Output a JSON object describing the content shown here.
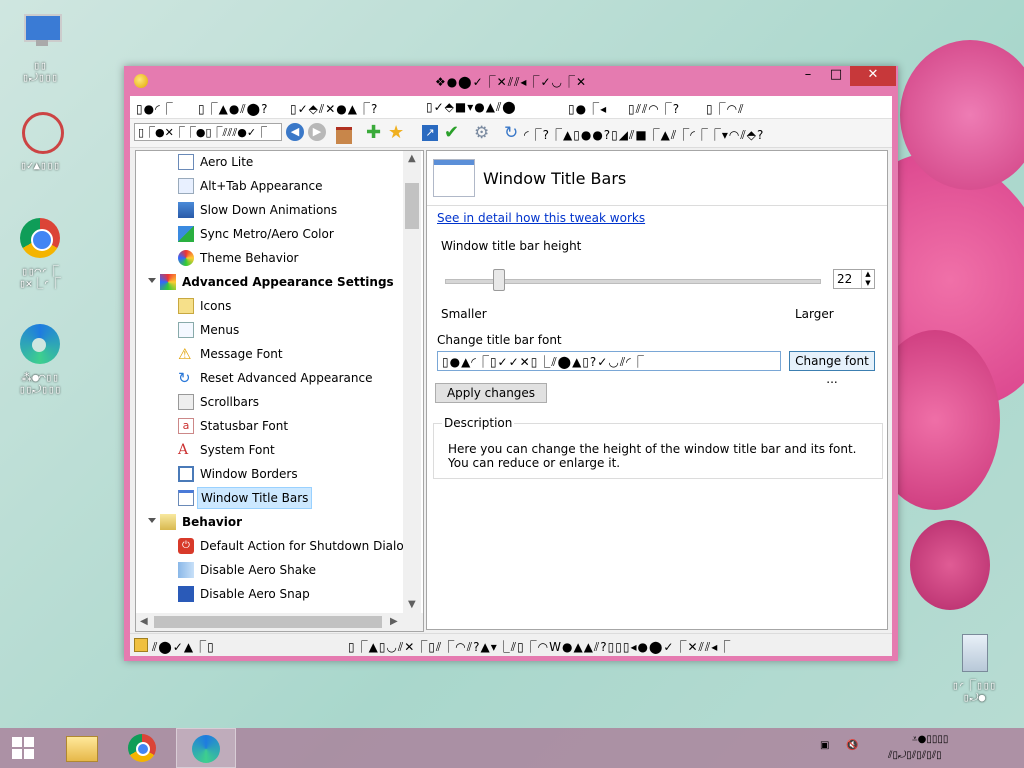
{
  "desktop": {
    "icons": [
      {
        "name": "this-pc",
        "label": "▯▯\n▯⤾▯▯▯"
      },
      {
        "name": "app-icon-2",
        "label": "▯✓▲▯▯▯"
      },
      {
        "name": "google-chrome",
        "label": "▯▯◠◜⎾\n▯✕⎿◜⎾"
      },
      {
        "name": "edge-app",
        "label": "⁂●◠▯▯\n▯▯⤾▯▯▯"
      },
      {
        "name": "recycle-bin",
        "label": "▯◜⎾▯▯▯\n▯⤾●"
      }
    ]
  },
  "window": {
    "title": "❖●⬤✓⎾✕⫽⫽◂⎾✓◡⎾✕",
    "menu": [
      "▯●◜⎾",
      "▯⎾▲●⫽⬤?",
      "▯✓⬘⫽✕●▲⎾?",
      "▯✓⬘■▾●▲⫽⬤",
      "▯●⎾◂",
      "▯⫽⫽◠⎾?",
      "▯⎾◠⫽"
    ],
    "toolbar": {
      "search_value": "▯⎾●✕⎾⎾●▯⎾⫽⫽⫽●✓⎾",
      "label": "◜⎾?⎾▲▯●●?▯◢⫽■⎾▲⫽⎾◜⎾⎾▾◠⫽⬘?"
    },
    "tree": {
      "items": [
        {
          "label": "Aero Lite",
          "icon": "window-icon",
          "type": "child"
        },
        {
          "label": "Alt+Tab Appearance",
          "icon": "alttab-icon",
          "type": "child"
        },
        {
          "label": "Slow Down Animations",
          "icon": "animation-icon",
          "type": "child"
        },
        {
          "label": "Sync Metro/Aero Color",
          "icon": "color-sync-icon",
          "type": "child"
        },
        {
          "label": "Theme Behavior",
          "icon": "theme-icon",
          "type": "child"
        },
        {
          "label": "Advanced Appearance Settings",
          "icon": "appearance-icon",
          "type": "group"
        },
        {
          "label": "Icons",
          "icon": "icons-icon",
          "type": "child"
        },
        {
          "label": "Menus",
          "icon": "menus-icon",
          "type": "child"
        },
        {
          "label": "Message Font",
          "icon": "warning-icon",
          "type": "child"
        },
        {
          "label": "Reset Advanced Appearance",
          "icon": "reset-icon",
          "type": "child"
        },
        {
          "label": "Scrollbars",
          "icon": "scrollbar-icon",
          "type": "child"
        },
        {
          "label": "Statusbar Font",
          "icon": "statusbar-font-icon",
          "type": "child"
        },
        {
          "label": "System Font",
          "icon": "system-font-icon",
          "type": "child"
        },
        {
          "label": "Window Borders",
          "icon": "window-borders-icon",
          "type": "child"
        },
        {
          "label": "Window Title Bars",
          "icon": "title-bar-icon",
          "type": "child",
          "selected": true
        },
        {
          "label": "Behavior",
          "icon": "behavior-icon",
          "type": "group"
        },
        {
          "label": "Default Action for Shutdown Dialog",
          "icon": "shutdown-icon",
          "type": "child"
        },
        {
          "label": "Disable Aero Shake",
          "icon": "shake-icon",
          "type": "child"
        },
        {
          "label": "Disable Aero Snap",
          "icon": "snap-icon",
          "type": "child"
        }
      ]
    },
    "content": {
      "title": "Window Title Bars",
      "detail_link": "See in detail how this tweak works",
      "height_label": "Window title bar height",
      "slider_value": 22,
      "smaller_label": "Smaller",
      "larger_label": "Larger",
      "font_label": "Change title bar font",
      "font_value": "▯●▲◜⎾▯✓✓✕▯⎿⫽⬤▲▯?✓◡⫽◜⎾",
      "change_font_button": "Change font ...",
      "apply_button": "Apply changes",
      "description_title": "Description",
      "description_text": "Here you can change the height of the window title bar and its font. You can reduce or enlarge it."
    },
    "status": {
      "left": "⫽⬤✓▲⎾▯",
      "right": "▯⎾▲▯◡⫽✕⎾▯⫽⎾◠⫽?▲▾⎿⫽▯⎾◠W●▲▲⫽?▯▯▯◂●⬤✓⎾✕⫽⫽◂⎾"
    }
  },
  "taskbar": {
    "items": [
      "start",
      "file-explorer",
      "google-chrome",
      "edge-app"
    ],
    "clock_line1": "⩡●▯▯▯▯",
    "clock_line2": "⫽▯⤾▯⫽▯⫽▯⫽▯"
  },
  "colors": {
    "window_frame": "#e57bb0",
    "close_button": "#c7383a",
    "selection": "#cce8ff"
  }
}
